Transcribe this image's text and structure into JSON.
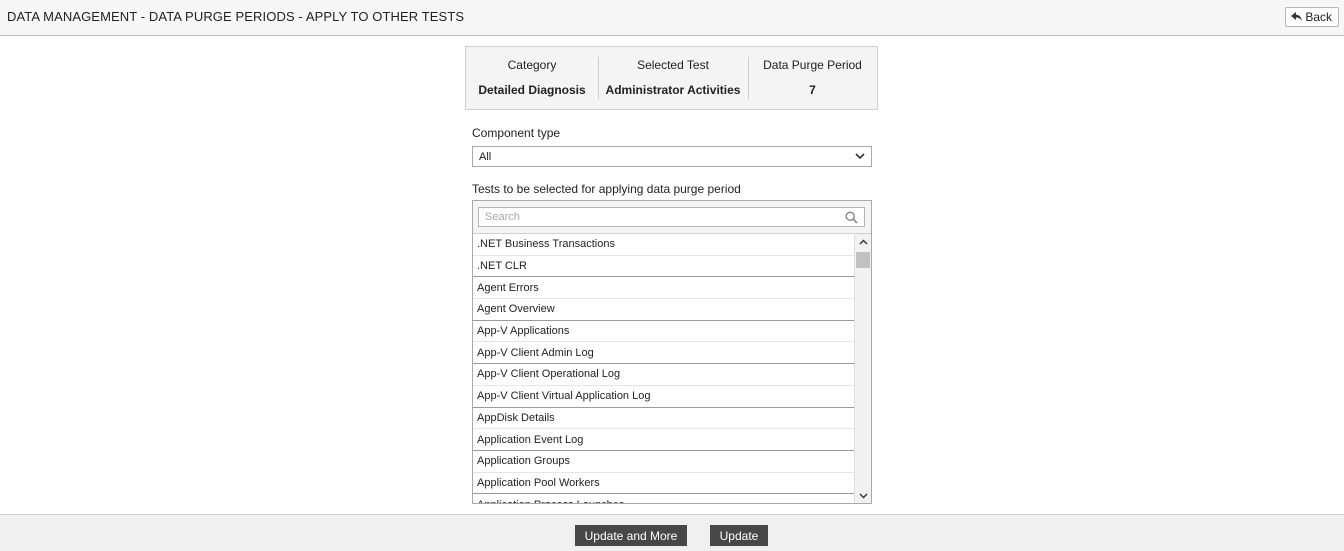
{
  "header": {
    "title": "DATA MANAGEMENT - DATA PURGE PERIODS - APPLY TO OTHER TESTS",
    "back_label": "Back"
  },
  "summary": {
    "category_label": "Category",
    "category_value": "Detailed Diagnosis",
    "test_label": "Selected Test",
    "test_value": "Administrator Activities",
    "period_label": "Data Purge Period",
    "period_value": "7"
  },
  "component": {
    "label": "Component type",
    "selected": "All"
  },
  "tests": {
    "label": "Tests to be selected for applying data purge period",
    "search_placeholder": "Search",
    "items": [
      ".NET Business Transactions",
      ".NET CLR",
      "Agent Errors",
      "Agent Overview",
      "App-V Applications",
      "App-V Client Admin Log",
      "App-V Client Operational Log",
      "App-V Client Virtual Application Log",
      "AppDisk Details",
      "Application Event Log",
      "Application Groups",
      "Application Pool Workers",
      "Application Process Launches"
    ]
  },
  "footer": {
    "update_more_label": "Update and More",
    "update_label": "Update"
  },
  "colors": {
    "button_bg": "#474747",
    "header_bg": "#f7f7f7",
    "panel_bg": "#f4f4f4"
  }
}
